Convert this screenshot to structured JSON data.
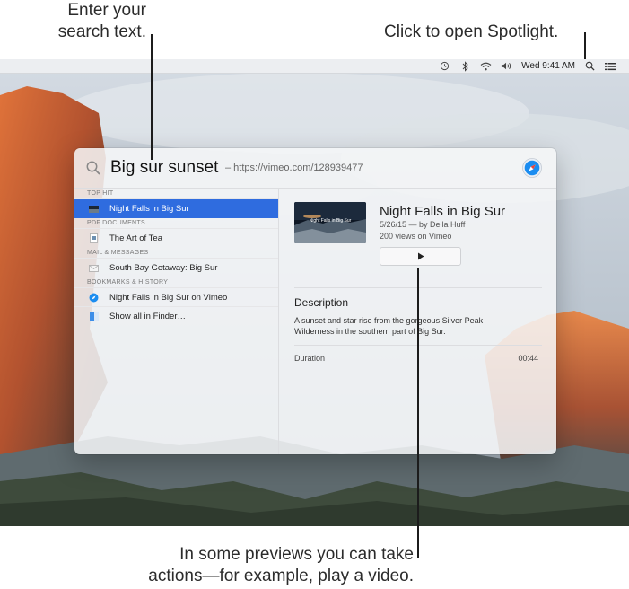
{
  "callouts": {
    "search_line1": "Enter your",
    "search_line2": "search text.",
    "spotlight": "Click to open Spotlight.",
    "preview_line1": "In some previews you can take",
    "preview_line2": "actions—for example, play a video."
  },
  "menubar": {
    "icons": [
      "time-machine-icon",
      "bluetooth-icon",
      "wifi-icon",
      "volume-icon",
      "spotlight-search-icon",
      "notification-center-icon"
    ],
    "clock": "Wed 9:41 AM"
  },
  "spotlight": {
    "query": "Big sur sunset",
    "hint": "– https://vimeo.com/128939477",
    "sections": [
      {
        "header": "TOP HIT",
        "items": [
          {
            "label": "Night Falls in Big Sur",
            "icon": "video-thumbnail-icon",
            "selected": true
          }
        ]
      },
      {
        "header": "PDF DOCUMENTS",
        "items": [
          {
            "label": "The Art of Tea",
            "icon": "pdf-icon",
            "selected": false
          }
        ]
      },
      {
        "header": "MAIL & MESSAGES",
        "items": [
          {
            "label": "South Bay Getaway: Big Sur",
            "icon": "mail-icon",
            "selected": false
          }
        ]
      },
      {
        "header": "BOOKMARKS & HISTORY",
        "items": [
          {
            "label": "Night Falls in Big Sur on Vimeo",
            "icon": "safari-icon",
            "selected": false
          }
        ]
      }
    ],
    "show_all": "Show all in Finder…",
    "preview": {
      "thumbnail_text": "Night Falls in Big Sur",
      "title": "Night Falls in Big Sur",
      "meta1": "5/26/15 — by Della Huff",
      "meta2": "200 views on Vimeo",
      "description_header": "Description",
      "description": "A sunset and star rise from the gorgeous Silver Peak Wilderness in the southern part of Big Sur.",
      "duration_label": "Duration",
      "duration_value": "00:44"
    }
  },
  "colors": {
    "selection": "#2f6cdf",
    "accent_safari": "#1a8cf0"
  }
}
